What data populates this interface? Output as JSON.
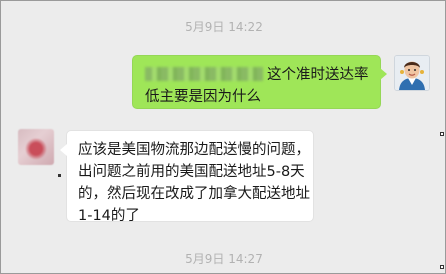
{
  "chat": {
    "messages": [
      {
        "timestamp": "5月9日 14:22",
        "direction": "outgoing",
        "lines": [
          "这个准时送达率",
          "低主要是因为什么"
        ]
      },
      {
        "direction": "incoming",
        "lines": [
          "应该是美国物流那边配送慢的问题，",
          "出问题之前用的美国配送地址5-8天",
          "的，然后现在改成了加拿大配送地址",
          "1-14的了"
        ]
      },
      {
        "timestamp": "5月9日 14:27"
      }
    ]
  },
  "colors": {
    "outgoing_bubble": "#9fe658",
    "incoming_bubble": "#ffffff",
    "timestamp_text": "#b2b2b2",
    "background": "#ececec"
  }
}
